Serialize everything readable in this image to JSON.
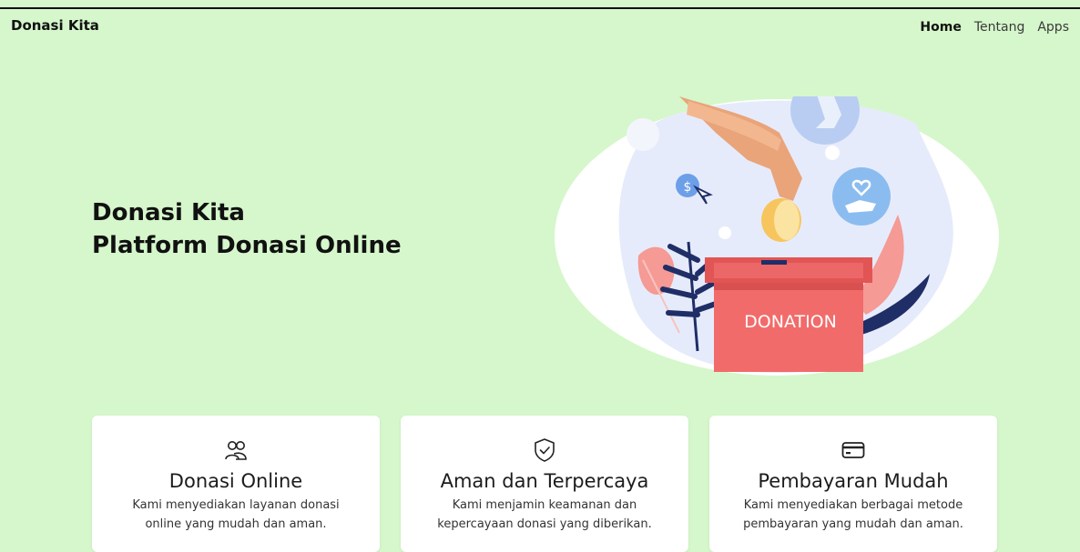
{
  "header": {
    "brand": "Donasi Kita",
    "nav": [
      "Home",
      "Tentang",
      "Apps"
    ]
  },
  "hero": {
    "line1": "Donasi Kita",
    "line2": "Platform Donasi Online",
    "image_text": "DONATION"
  },
  "cards": [
    {
      "icon": "users-icon",
      "title": "Donasi Online",
      "text": "Kami menyediakan layanan donasi online yang mudah dan aman."
    },
    {
      "icon": "shield-check-icon",
      "title": "Aman dan Terpercaya",
      "text": "Kami menjamin keamanan dan kepercayaan donasi yang diberikan."
    },
    {
      "icon": "credit-card-icon",
      "title": "Pembayaran Mudah",
      "text": "Kami menyediakan berbagai metode pembayaran yang mudah dan aman."
    }
  ],
  "colors": {
    "background": "#d5f7cb",
    "donation_box": "#f26b6b"
  }
}
